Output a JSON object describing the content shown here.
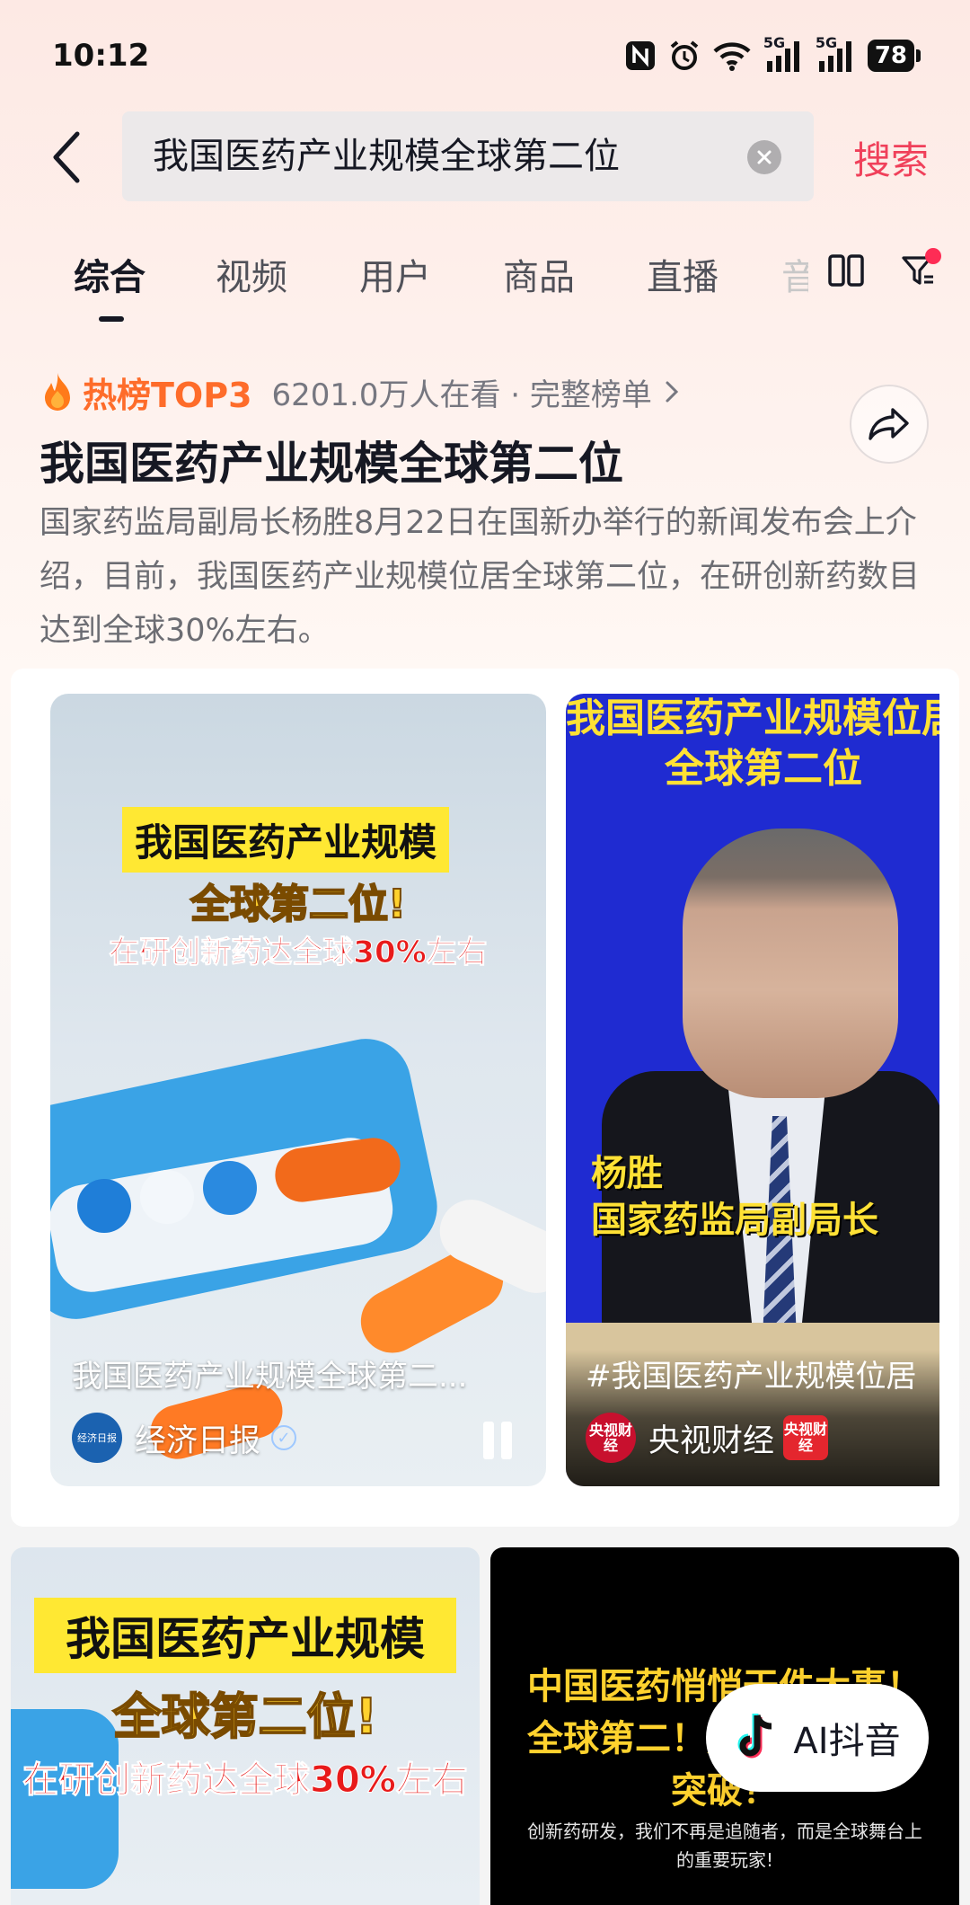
{
  "status_bar": {
    "time": "10:12",
    "signal_1": "5G",
    "signal_2": "5G",
    "battery": "78"
  },
  "search": {
    "query": "我国医药产业规模全球第二位",
    "search_label": "搜索"
  },
  "tabs": [
    {
      "label": "综合",
      "active": true
    },
    {
      "label": "视频"
    },
    {
      "label": "用户"
    },
    {
      "label": "商品"
    },
    {
      "label": "直播"
    },
    {
      "label": "音"
    }
  ],
  "hot_topic": {
    "rank": "热榜TOP3",
    "viewers": "6201.0万人在看 · 完整榜单",
    "title": "我国医药产业规模全球第二位",
    "description": "国家药监局副局长杨胜8月22日在国新办举行的新闻发布会上介绍，目前，我国医药产业规模位居全球第二位，在研创新药数目达到全球30%左右。"
  },
  "videos": [
    {
      "caption_line1": "我国医药产业规模",
      "caption_line2": "全球第二位!",
      "caption_line3": "在研创新药达全球30%左右",
      "title": "我国医药产业规模全球第二...",
      "author": "经济日报",
      "avatar_text": "经济日报"
    },
    {
      "caption_top": "我国医药产业规模位居全球第二位",
      "speaker_name": "杨胜",
      "speaker_title": "国家药监局副局长",
      "title": "#我国医药产业规模位居",
      "author": "央视财经",
      "avatar_text": "央视财经",
      "badge_text": "央视财经"
    }
  ],
  "grid": [
    {
      "caption_line1": "我国医药产业规模",
      "caption_line2": "全球第二位!",
      "caption_line3": "在研创新药达全球30%左右"
    },
    {
      "caption_title": "中国医药悄悄干件大事！全球第二！藏着哪些惊人突破？",
      "caption_sub": "创新药研发，我们不再是追随者，而是全球舞台上的重要玩家!"
    }
  ],
  "ai_button": {
    "label": "AI抖音"
  },
  "colors": {
    "accent": "#f0405a",
    "hot_orange": "#fe6c2a",
    "text_primary": "#161823",
    "text_secondary": "#6c6d73"
  }
}
